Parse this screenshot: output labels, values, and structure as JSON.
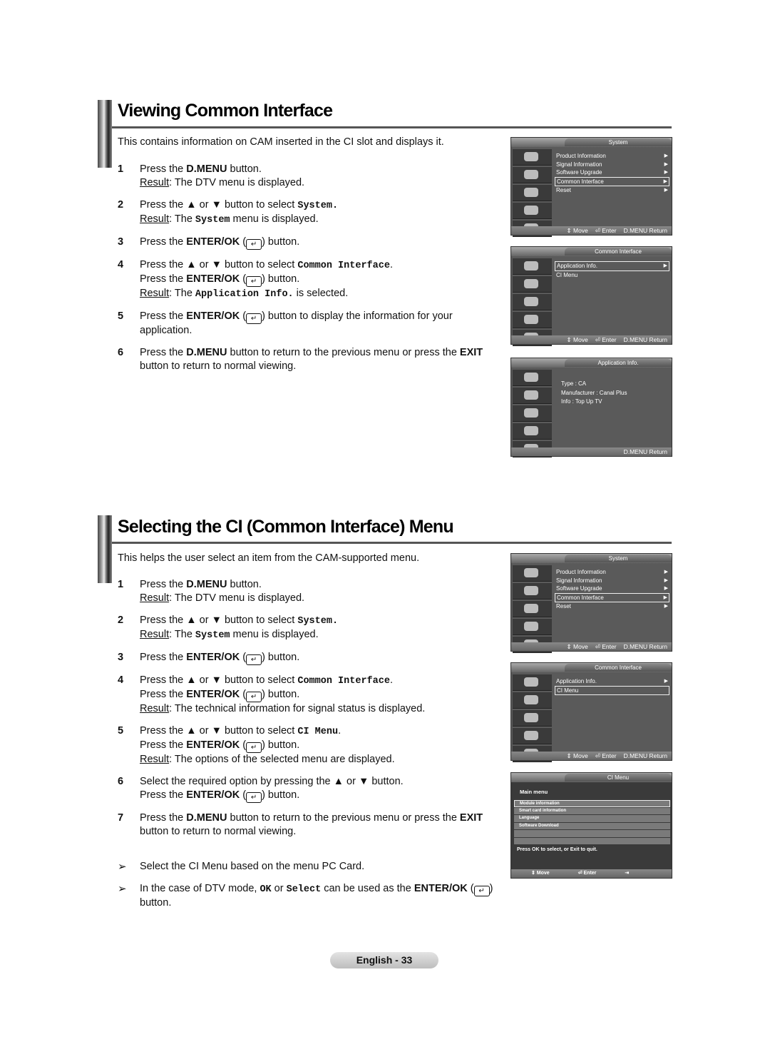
{
  "sections": [
    {
      "title": "Viewing Common Interface",
      "intro": "This contains information on CAM inserted in the CI slot and displays it.",
      "steps": [
        {
          "num": "1",
          "lines": [
            [
              {
                "t": "Press the "
              },
              {
                "b": "D.MENU"
              },
              {
                "t": " button."
              }
            ],
            [
              {
                "u": "Result"
              },
              {
                "t": ": The DTV menu is displayed."
              }
            ]
          ]
        },
        {
          "num": "2",
          "lines": [
            [
              {
                "t": "Press the ▲ or ▼ button to select "
              },
              {
                "m": "System."
              }
            ],
            [
              {
                "u": "Result"
              },
              {
                "t": ": The "
              },
              {
                "m": "System"
              },
              {
                "t": " menu is displayed."
              }
            ]
          ]
        },
        {
          "num": "3",
          "lines": [
            [
              {
                "t": "Press the "
              },
              {
                "b": "ENTER/OK"
              },
              {
                "t": " ("
              },
              {
                "icon": "↵"
              },
              {
                "t": ") button."
              }
            ]
          ]
        },
        {
          "num": "4",
          "lines": [
            [
              {
                "t": "Press the ▲ or ▼ button to select "
              },
              {
                "m": "Common Interface"
              },
              {
                "t": "."
              }
            ],
            [
              {
                "t": "Press the "
              },
              {
                "b": "ENTER/OK"
              },
              {
                "t": " ("
              },
              {
                "icon": "↵"
              },
              {
                "t": ") button."
              }
            ],
            [
              {
                "u": "Result"
              },
              {
                "t": ": The "
              },
              {
                "m": "Application Info."
              },
              {
                "t": " is selected."
              }
            ]
          ]
        },
        {
          "num": "5",
          "lines": [
            [
              {
                "t": "Press the "
              },
              {
                "b": "ENTER/OK"
              },
              {
                "t": " ("
              },
              {
                "icon": "↵"
              },
              {
                "t": ") button to display the information for your"
              }
            ],
            [
              {
                "t": "application."
              }
            ]
          ]
        },
        {
          "num": "6",
          "lines": [
            [
              {
                "t": "Press the "
              },
              {
                "b": "D.MENU"
              },
              {
                "t": " button to return to the previous menu or press the "
              },
              {
                "b": "EXIT"
              }
            ],
            [
              {
                "t": "button to return to normal viewing."
              }
            ]
          ]
        }
      ],
      "notes": []
    },
    {
      "title": "Selecting the CI (Common Interface) Menu",
      "intro": "This helps the user select an item from the CAM-supported menu.",
      "steps": [
        {
          "num": "1",
          "lines": [
            [
              {
                "t": "Press the "
              },
              {
                "b": "D.MENU"
              },
              {
                "t": " button."
              }
            ],
            [
              {
                "u": "Result"
              },
              {
                "t": ": The DTV menu is displayed."
              }
            ]
          ]
        },
        {
          "num": "2",
          "lines": [
            [
              {
                "t": "Press the ▲ or ▼ button to select "
              },
              {
                "m": "System."
              }
            ],
            [
              {
                "u": "Result"
              },
              {
                "t": ": The "
              },
              {
                "m": "System"
              },
              {
                "t": " menu is displayed."
              }
            ]
          ]
        },
        {
          "num": "3",
          "lines": [
            [
              {
                "t": "Press the "
              },
              {
                "b": "ENTER/OK"
              },
              {
                "t": " ("
              },
              {
                "icon": "↵"
              },
              {
                "t": ") button."
              }
            ]
          ]
        },
        {
          "num": "4",
          "lines": [
            [
              {
                "t": "Press the ▲ or ▼ button to select "
              },
              {
                "m": "Common Interface"
              },
              {
                "t": "."
              }
            ],
            [
              {
                "t": "Press the "
              },
              {
                "b": "ENTER/OK"
              },
              {
                "t": " ("
              },
              {
                "icon": "↵"
              },
              {
                "t": ") button."
              }
            ],
            [
              {
                "u": "Result"
              },
              {
                "t": ": The technical information for signal status is displayed."
              }
            ]
          ]
        },
        {
          "num": "5",
          "lines": [
            [
              {
                "t": "Press the ▲ or ▼ button to select "
              },
              {
                "m": "CI Menu"
              },
              {
                "t": "."
              }
            ],
            [
              {
                "t": "Press the "
              },
              {
                "b": "ENTER/OK"
              },
              {
                "t": " ("
              },
              {
                "icon": "↵"
              },
              {
                "t": ") button."
              }
            ],
            [
              {
                "u": "Result"
              },
              {
                "t": ": The options of the selected menu are displayed."
              }
            ]
          ]
        },
        {
          "num": "6",
          "lines": [
            [
              {
                "t": "Select the required option by pressing the ▲ or ▼ button."
              }
            ],
            [
              {
                "t": "Press the "
              },
              {
                "b": "ENTER/OK"
              },
              {
                "t": " ("
              },
              {
                "icon": "↵"
              },
              {
                "t": ") button."
              }
            ]
          ]
        },
        {
          "num": "7",
          "lines": [
            [
              {
                "t": "Press the "
              },
              {
                "b": "D.MENU"
              },
              {
                "t": " button to return to the previous menu or press the "
              },
              {
                "b": "EXIT"
              }
            ],
            [
              {
                "t": "button to return to normal viewing."
              }
            ]
          ]
        }
      ],
      "notes": [
        {
          "arrow": "➢",
          "lines": [
            [
              {
                "t": "Select the CI Menu based on the menu PC Card."
              }
            ]
          ]
        },
        {
          "arrow": "➢",
          "lines": [
            [
              {
                "t": "In the case of DTV mode, "
              },
              {
                "m": "OK"
              },
              {
                "t": " or "
              },
              {
                "m": "Select"
              },
              {
                "t": " can be used as the "
              },
              {
                "b": "ENTER/OK"
              },
              {
                "t": " ("
              },
              {
                "icon": "↵"
              },
              {
                "t": ")"
              }
            ],
            [
              {
                "t": "button."
              }
            ]
          ]
        }
      ]
    }
  ],
  "screens": [
    {
      "kind": "menu",
      "title": "System",
      "items": [
        {
          "label": "Product Information",
          "arrow": true
        },
        {
          "label": "Signal Information",
          "arrow": true
        },
        {
          "label": "Software Upgrade",
          "arrow": true
        },
        {
          "label": "Common Interface",
          "arrow": true,
          "selected": true
        },
        {
          "label": "Reset",
          "arrow": true
        }
      ],
      "footer": [
        "⇕ Move",
        "⏎ Enter",
        "D.MENU Return"
      ]
    },
    {
      "kind": "menu",
      "title": "Common Interface",
      "items": [
        {
          "label": "Application Info.",
          "arrow": true,
          "selected": true
        },
        {
          "label": "CI Menu",
          "arrow": false
        }
      ],
      "footer": [
        "⇕ Move",
        "⏎ Enter",
        "D.MENU Return"
      ]
    },
    {
      "kind": "info",
      "title": "Application Info.",
      "lines": [
        "Type : CA",
        "Manufacturer : Canal Plus",
        "Info : Top Up TV"
      ],
      "footer": [
        "D.MENU Return"
      ]
    },
    {
      "kind": "menu",
      "title": "System",
      "items": [
        {
          "label": "Product Information",
          "arrow": true
        },
        {
          "label": "Signal Information",
          "arrow": true
        },
        {
          "label": "Software Upgrade",
          "arrow": true
        },
        {
          "label": "Common Interface",
          "arrow": true,
          "selected": true
        },
        {
          "label": "Reset",
          "arrow": true
        }
      ],
      "footer": [
        "⇕ Move",
        "⏎ Enter",
        "D.MENU Return"
      ]
    },
    {
      "kind": "menu",
      "title": "Common Interface",
      "items": [
        {
          "label": "Application Info.",
          "arrow": true
        },
        {
          "label": "CI Menu",
          "arrow": false,
          "selected": true
        }
      ],
      "footer": [
        "⇕ Move",
        "⏎ Enter",
        "D.MENU Return"
      ]
    },
    {
      "kind": "ci",
      "title": "CI Menu",
      "main": "Main menu",
      "rows": [
        {
          "label": "Module information",
          "selected": true
        },
        {
          "label": "Smart card information"
        },
        {
          "label": "Language"
        },
        {
          "label": "Software Download"
        },
        {
          "label": ""
        },
        {
          "label": ""
        }
      ],
      "hint": "Press OK to select, or Exit to quit.",
      "footer": [
        "⇕ Move",
        "⏎ Enter",
        "⇥ Exit"
      ]
    }
  ],
  "footer": {
    "page": "English - 33"
  }
}
